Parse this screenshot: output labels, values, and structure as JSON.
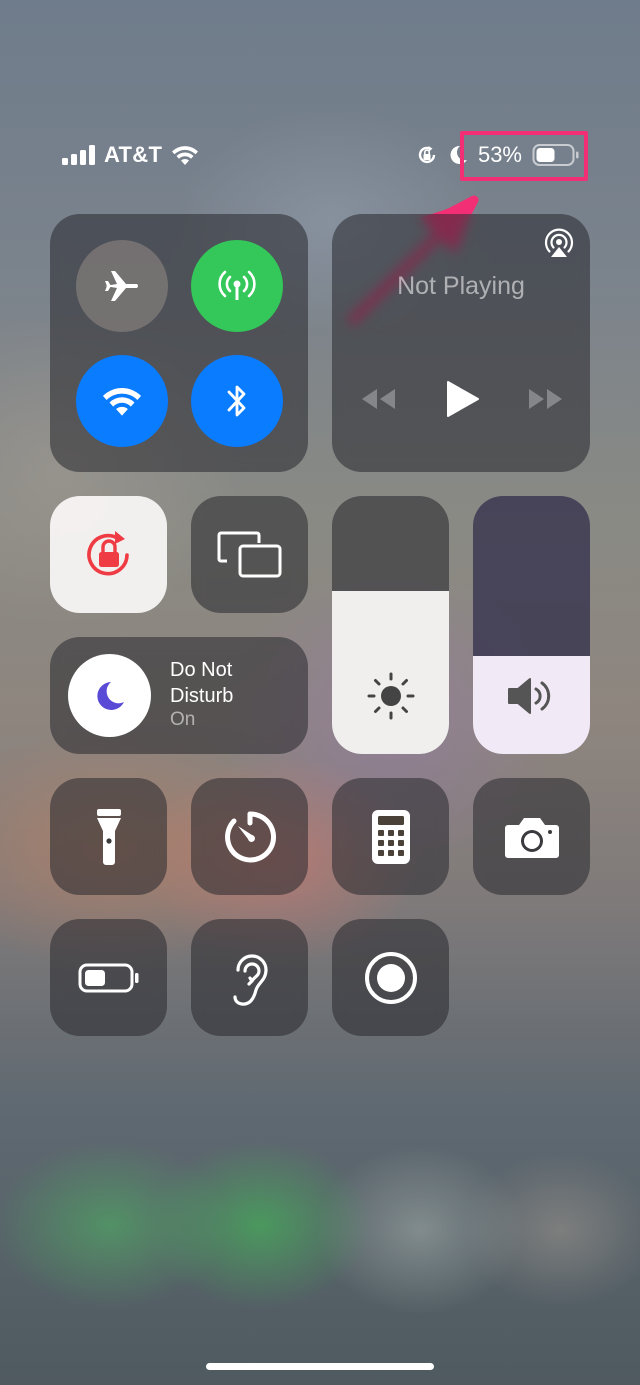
{
  "status_bar": {
    "carrier": "AT&T",
    "battery_percent": "53%",
    "battery_level": 0.53,
    "icons": [
      "signal-icon",
      "wifi-icon",
      "orientation-lock-icon",
      "do-not-disturb-moon-icon",
      "battery-icon"
    ]
  },
  "connectivity": {
    "airplane_mode": {
      "icon": "airplane-icon",
      "on": false
    },
    "cellular_data": {
      "icon": "antenna-icon",
      "on": true
    },
    "wifi": {
      "icon": "wifi-icon",
      "on": true
    },
    "bluetooth": {
      "icon": "bluetooth-icon",
      "on": true
    }
  },
  "media": {
    "title": "Not Playing",
    "icons": [
      "airplay-icon",
      "rewind-icon",
      "play-icon",
      "fast-forward-icon"
    ]
  },
  "controls": {
    "orientation_lock": {
      "icon": "orientation-lock-icon",
      "on": true
    },
    "screen_mirroring": {
      "icon": "screen-mirroring-icon"
    },
    "do_not_disturb": {
      "title": "Do Not Disturb",
      "status": "On",
      "icon": "moon-icon"
    },
    "brightness": {
      "icon": "sun-icon",
      "level": 0.63
    },
    "volume": {
      "icon": "speaker-icon",
      "level": 0.38
    }
  },
  "shortcuts": [
    {
      "icon": "flashlight-icon"
    },
    {
      "icon": "timer-icon"
    },
    {
      "icon": "calculator-icon"
    },
    {
      "icon": "camera-icon"
    },
    {
      "icon": "low-power-mode-icon"
    },
    {
      "icon": "hearing-icon"
    },
    {
      "icon": "screen-recording-icon"
    }
  ],
  "colors": {
    "accent_blue": "#0a7cff",
    "accent_green": "#34c759",
    "highlight": "#f22f74",
    "orientation_lock_red": "#ef3b43",
    "dnd_purple": "#5a4bd6"
  }
}
